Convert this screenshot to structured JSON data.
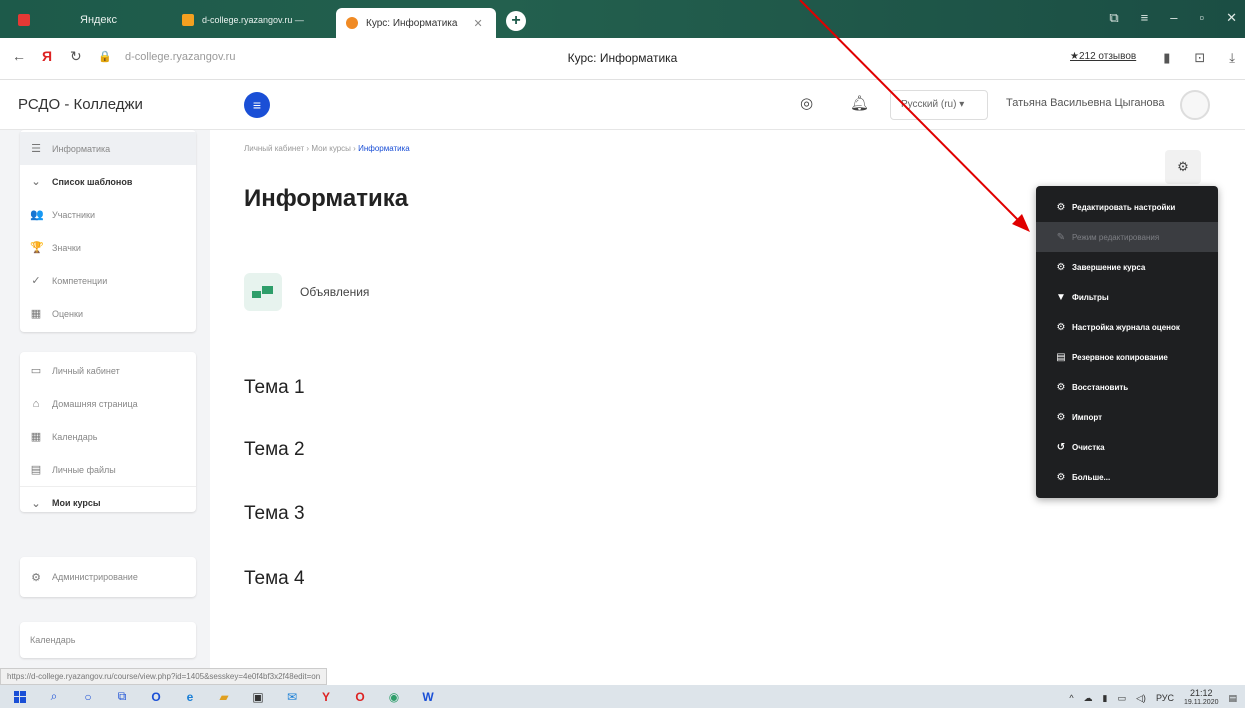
{
  "browser": {
    "tabs": [
      {
        "label": "Яндекс"
      },
      {
        "label": "d-college.ryazangov.ru —"
      },
      {
        "label": "Курс: Информатика"
      }
    ],
    "new_tab": "+",
    "url": "d-college.ryazangov.ru",
    "page_title": "Курс: Информатика",
    "reviews": "★212 отзывов"
  },
  "header": {
    "brand": "РСДО - Колледжи",
    "menu_icon": "≡",
    "language": "Русский (ru) ▾",
    "user_name": "Татьяна Васильевна Цыганова"
  },
  "sidebar": {
    "course_items": [
      {
        "icon": "☰",
        "label": "Информатика"
      },
      {
        "icon": "⌄",
        "label": "Список шаблонов"
      },
      {
        "icon": "👥",
        "label": "Участники"
      },
      {
        "icon": "🏆",
        "label": "Значки"
      },
      {
        "icon": "✓",
        "label": "Компетенции"
      },
      {
        "icon": "▦",
        "label": "Оценки"
      }
    ],
    "nav_items": [
      {
        "icon": "▭",
        "label": "Личный кабинет"
      },
      {
        "icon": "⌂",
        "label": "Домашняя страница"
      },
      {
        "icon": "▦",
        "label": "Календарь"
      },
      {
        "icon": "▤",
        "label": "Личные файлы"
      }
    ],
    "my_courses": {
      "icon": "⌄",
      "label": "Мои курсы"
    },
    "admin": {
      "icon": "⚙",
      "label": "Администрирование"
    },
    "bottom": "Календарь"
  },
  "main": {
    "breadcrumb": {
      "part1": "Личный кабинет",
      "part2": "Мои курсы",
      "current": "Информатика",
      "sep": "›"
    },
    "title": "Информатика",
    "announcements": "Объявления",
    "topics": [
      "Тема 1",
      "Тема 2",
      "Тема 3",
      "Тема 4"
    ]
  },
  "dropdown": {
    "items": [
      {
        "icon": "⚙",
        "label": "Редактировать настройки"
      },
      {
        "icon": "✎",
        "label": "Режим редактирования"
      },
      {
        "icon": "⚙",
        "label": "Завершение курса"
      },
      {
        "icon": "▼",
        "label": "Фильтры"
      },
      {
        "icon": "⚙",
        "label": "Настройка журнала оценок"
      },
      {
        "icon": "▤",
        "label": "Резервное копирование"
      },
      {
        "icon": "⚙",
        "label": "Восстановить"
      },
      {
        "icon": "⚙",
        "label": "Импорт"
      },
      {
        "icon": "↺",
        "label": "Очистка"
      },
      {
        "icon": "⚙",
        "label": "Больше..."
      }
    ]
  },
  "status_url": "https://d-college.ryazangov.ru/course/view.php?id=1405&sesskey=4e0f4bf3x2f48edit=on",
  "taskbar": {
    "time": "21:12",
    "date": "19.11.2020",
    "lang": "РУС"
  },
  "colors": {
    "accent": "#1a4fd6",
    "menu_bg": "#1e1f21",
    "arrow": "#e00000"
  }
}
